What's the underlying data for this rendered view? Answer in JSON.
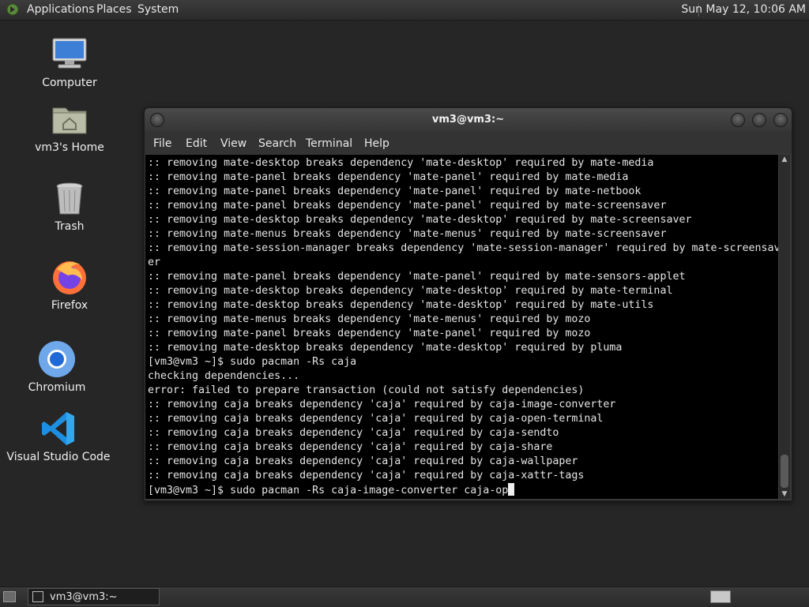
{
  "top_panel": {
    "menus": [
      "Applications",
      "Places",
      "System"
    ],
    "clock": "Sun May 12, 10:06 AM"
  },
  "desktop_icons": [
    {
      "label": "Computer",
      "icon": "computer-icon"
    },
    {
      "label": "vm3's Home",
      "icon": "home-folder-icon"
    },
    {
      "label": "Trash",
      "icon": "trash-icon"
    },
    {
      "label": "Firefox",
      "icon": "firefox-icon"
    },
    {
      "label": "Chromium",
      "icon": "chromium-icon"
    },
    {
      "label": "Visual Studio Code",
      "icon": "vscode-icon"
    }
  ],
  "window": {
    "title": "vm3@vm3:~",
    "menu": [
      "File",
      "Edit",
      "View",
      "Search",
      "Terminal",
      "Help"
    ]
  },
  "terminal": {
    "lines": [
      ":: removing mate-desktop breaks dependency 'mate-desktop' required by mate-media",
      ":: removing mate-panel breaks dependency 'mate-panel' required by mate-media",
      ":: removing mate-panel breaks dependency 'mate-panel' required by mate-netbook",
      ":: removing mate-panel breaks dependency 'mate-panel' required by mate-screensaver",
      ":: removing mate-desktop breaks dependency 'mate-desktop' required by mate-screensaver",
      ":: removing mate-menus breaks dependency 'mate-menus' required by mate-screensaver",
      ":: removing mate-session-manager breaks dependency 'mate-session-manager' required by mate-screensav",
      "er",
      ":: removing mate-panel breaks dependency 'mate-panel' required by mate-sensors-applet",
      ":: removing mate-desktop breaks dependency 'mate-desktop' required by mate-terminal",
      ":: removing mate-desktop breaks dependency 'mate-desktop' required by mate-utils",
      ":: removing mate-menus breaks dependency 'mate-menus' required by mozo",
      ":: removing mate-panel breaks dependency 'mate-panel' required by mozo",
      ":: removing mate-desktop breaks dependency 'mate-desktop' required by pluma",
      "[vm3@vm3 ~]$ sudo pacman -Rs caja",
      "checking dependencies...",
      "error: failed to prepare transaction (could not satisfy dependencies)",
      ":: removing caja breaks dependency 'caja' required by caja-image-converter",
      ":: removing caja breaks dependency 'caja' required by caja-open-terminal",
      ":: removing caja breaks dependency 'caja' required by caja-sendto",
      ":: removing caja breaks dependency 'caja' required by caja-share",
      ":: removing caja breaks dependency 'caja' required by caja-wallpaper",
      ":: removing caja breaks dependency 'caja' required by caja-xattr-tags"
    ],
    "prompt_line": "[vm3@vm3 ~]$ sudo pacman -Rs caja-image-converter caja-op"
  },
  "taskbar": {
    "task_label": "vm3@vm3:~"
  }
}
